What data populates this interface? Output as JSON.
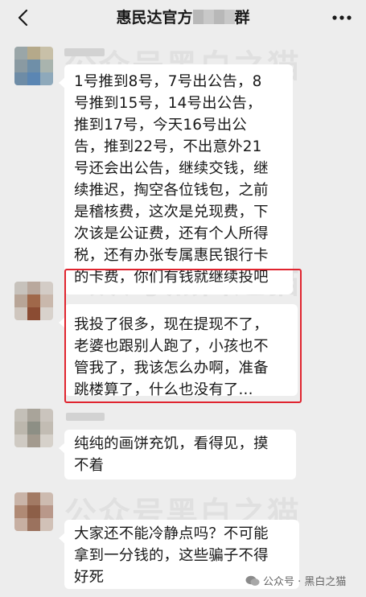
{
  "header": {
    "title_prefix": "惠民达官方",
    "title_suffix": "群"
  },
  "messages": [
    {
      "lines": [
        "1号推到8号，7号出公告，8",
        "号推到15号，14号出公告，",
        "推到17号，今天16号出公",
        "告，推到22号，不出意外21",
        "号还会出公告，继续交钱，继",
        "续推迟，掏空各位钱包，之前",
        "是稽核费，这次是兑现费，下",
        "次该是公证费，还有个人所得",
        "税，还有办张专属惠民银行卡",
        "的卡费，你们有钱就继续投吧"
      ]
    },
    {
      "lines": [
        "我投了很多，现在提现不了，",
        "老婆也跟别人跑了，小孩也不",
        "管我了，我该怎么办啊，准备",
        "跳楼算了，什么也没有了..."
      ],
      "highlighted": true
    },
    {
      "lines": [
        "纯纯的画饼充饥，看得见，摸",
        "不着"
      ]
    },
    {
      "lines": [
        "大家还不能冷静点吗？不可能",
        "拿到一分钱的，这些骗子不得",
        "好死"
      ]
    }
  ],
  "watermark": {
    "text": "公众号黑白之猫",
    "footer": "公众号 · 黑白之猫"
  },
  "colors": {
    "background": "#ededed",
    "bubble": "#ffffff",
    "highlight_border": "#e0242f"
  }
}
